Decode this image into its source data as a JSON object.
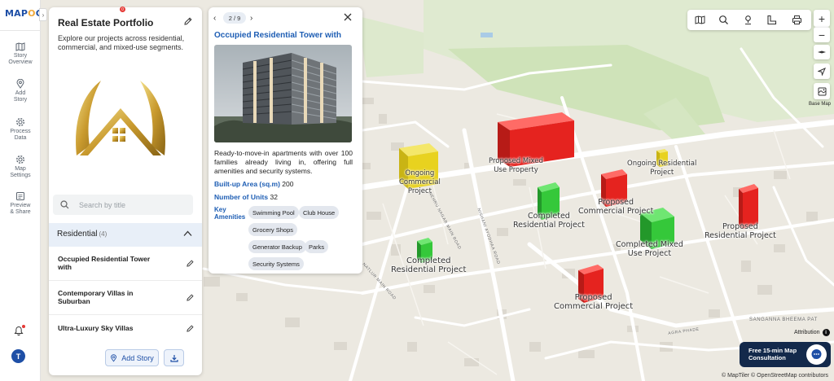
{
  "app": {
    "logo_text_a": "MAP",
    "logo_text_b": "O",
    "logo_text_c": "G"
  },
  "rail": {
    "items": [
      {
        "label_1": "Story",
        "label_2": "Overview",
        "icon": "map-book-icon"
      },
      {
        "label_1": "Add",
        "label_2": "Story",
        "icon": "location-pin-icon"
      },
      {
        "label_1": "Process",
        "label_2": "Data",
        "icon": "gear-icon"
      },
      {
        "label_1": "Map",
        "label_2": "Settings",
        "icon": "gear-icon"
      },
      {
        "label_1": "Preview",
        "label_2": "& Share",
        "icon": "share-icon"
      }
    ],
    "avatar_initial": "T"
  },
  "panel": {
    "title": "Real Estate Portfolio",
    "description": "Explore our projects across residential, commercial, and mixed-use segments.",
    "search_placeholder": "Search by title",
    "category": {
      "label": "Residential",
      "count": "(4)"
    },
    "stories": [
      {
        "title": "Occupied Residential Tower with"
      },
      {
        "title": "Contemporary Villas in Suburban"
      },
      {
        "title": "Ultra-Luxury Sky Villas"
      }
    ],
    "add_story_label": "Add Story"
  },
  "popup": {
    "pager": "2 / 9",
    "title": "Occupied Residential Tower with",
    "description": "Ready-to-move-in apartments with over 100 families already living in, offering full amenities and security systems.",
    "area_label": "Built-up Area (sq.m)",
    "area_value": "200",
    "units_label": "Number of Units",
    "units_value": "32",
    "amenities_label": "Key Amenities",
    "amenities": [
      "Swimming Pool",
      "Club House",
      "Grocery Shops",
      "Generator Backup",
      "Parks",
      "Security Systems"
    ]
  },
  "map": {
    "markers": [
      {
        "label_1": "Ongoing",
        "label_2": "Commercial",
        "label_3": "Project",
        "status": "ongoing"
      },
      {
        "label_1": "Proposed Mixed",
        "label_2": "Use Property",
        "status": "proposed"
      },
      {
        "label_1": "Ongoing Residential",
        "label_2": "Project",
        "status": "ongoing"
      },
      {
        "label_1": "Proposed",
        "label_2": "Commercial Project",
        "status": "proposed"
      },
      {
        "label_1": "Completed",
        "label_2": "Residential Project",
        "status": "completed"
      },
      {
        "label_1": "Completed Mixed",
        "label_2": "Use Project",
        "status": "completed"
      },
      {
        "label_1": "Proposed",
        "label_2": "Residential Project",
        "status": "proposed"
      },
      {
        "label_1": "Completed",
        "label_2": "Residential Project",
        "status": "completed"
      },
      {
        "label_1": "Proposed",
        "label_2": "Commercial Project",
        "status": "proposed"
      }
    ],
    "streets": [
      "SANGANNA BHEEMA PAT",
      "NEHRU NAGAR MAIN ROAD",
      "NISHANI AYODHAA ROAD",
      "NATLUR MAIN ROAD",
      "AGRA PHADE"
    ],
    "colors": {
      "ongoing": "#e8d21f",
      "proposed": "#e5231f",
      "completed": "#35c83a"
    },
    "basemap_label": "Base Map",
    "attribution_label": "Attribution",
    "consult_label": "Free 15-min Map Consultation",
    "copyright": "© MapTiler © OpenStreetMap contributors",
    "notification_badge": "0"
  }
}
